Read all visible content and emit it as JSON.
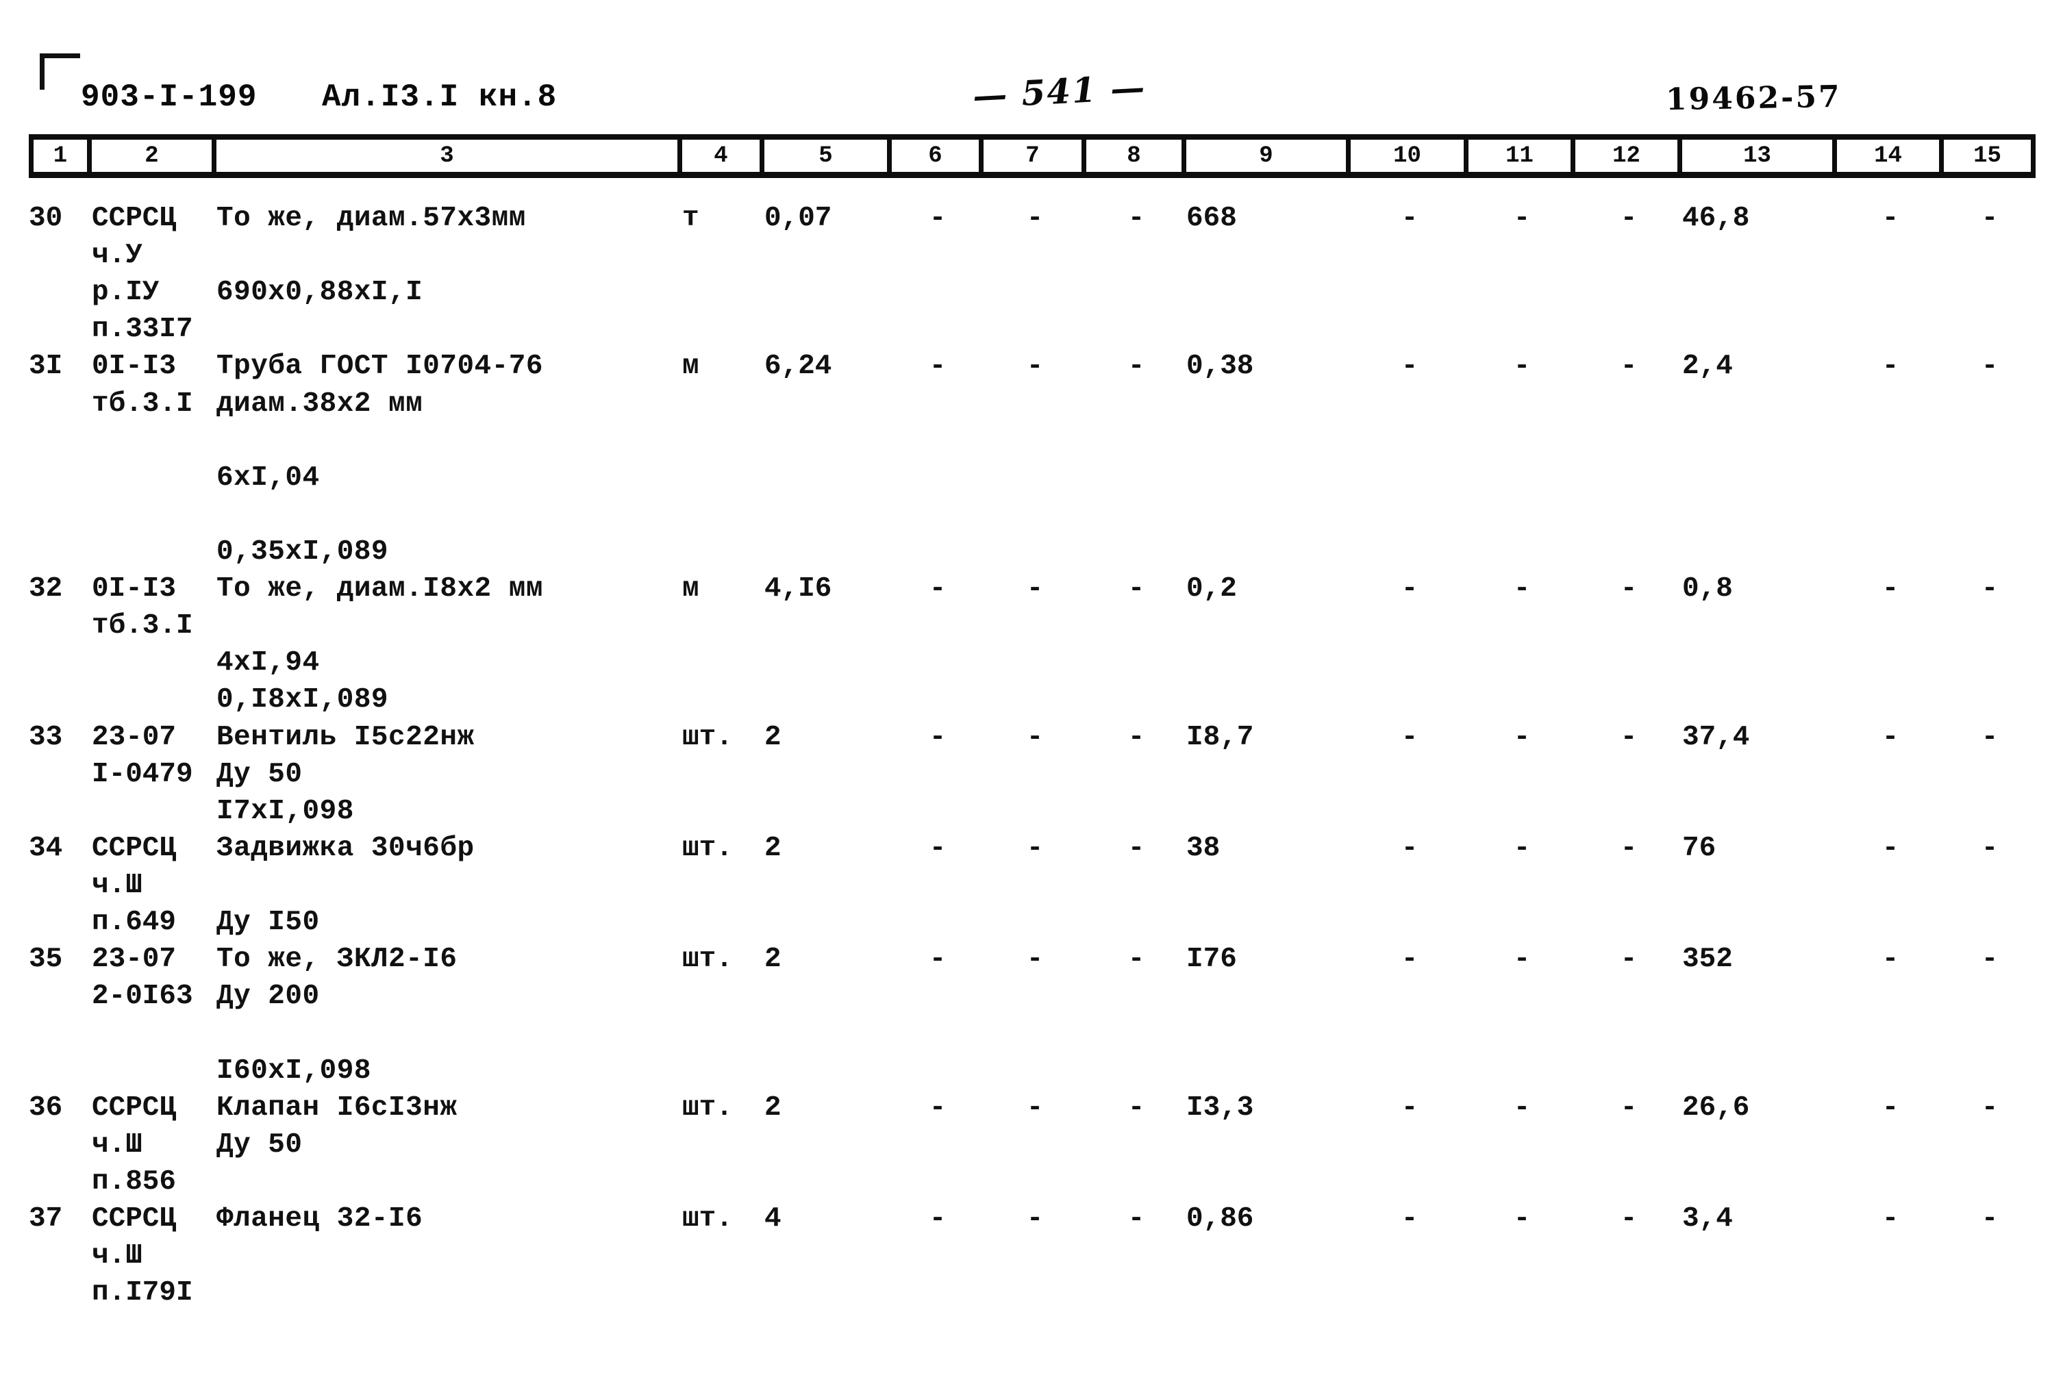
{
  "header": {
    "doc_code": "903-I-199",
    "album_ref": "Ал.I3.I кн.8",
    "page_number": "— 541 —",
    "archive_stamp": "19462-57"
  },
  "table": {
    "column_numbers": [
      "1",
      "2",
      "3",
      "4",
      "5",
      "6",
      "7",
      "8",
      "9",
      "10",
      "11",
      "12",
      "13",
      "14",
      "15"
    ],
    "dash": "-",
    "rows": [
      {
        "no": "30",
        "justification": "ССРСЦ\nч.У\nр.IУ\nп.33I7",
        "name": "То же, диам.57х3мм\n\n690х0,88хI,I",
        "unit": "т",
        "c5": "0,07",
        "c6": "-",
        "c7": "-",
        "c8": "-",
        "c9": "668",
        "c10": "-",
        "c11": "-",
        "c12": "-",
        "c13": "46,8",
        "c14": "-",
        "c15": "-"
      },
      {
        "no": "3I",
        "justification": "0I-I3\nтб.3.I",
        "name": "Труба ГОСТ I0704-76\nдиам.38х2 мм\n\n6хI,04\n\n0,35хI,089",
        "unit": "м",
        "c5": "6,24",
        "c6": "-",
        "c7": "-",
        "c8": "-",
        "c9": "0,38",
        "c10": "-",
        "c11": "-",
        "c12": "-",
        "c13": "2,4",
        "c14": "-",
        "c15": "-"
      },
      {
        "no": "32",
        "justification": "0I-I3\nтб.3.I",
        "name": "То же, диам.I8х2 мм\n\n4хI,94\n0,I8хI,089",
        "unit": "м",
        "c5": "4,I6",
        "c6": "-",
        "c7": "-",
        "c8": "-",
        "c9": "0,2",
        "c10": "-",
        "c11": "-",
        "c12": "-",
        "c13": "0,8",
        "c14": "-",
        "c15": "-"
      },
      {
        "no": "33",
        "justification": "23-07\nI-0479",
        "name": "Вентиль I5с22нж\nДу 50\nI7хI,098",
        "unit": "шт.",
        "c5": "2",
        "c6": "-",
        "c7": "-",
        "c8": "-",
        "c9": "I8,7",
        "c10": "-",
        "c11": "-",
        "c12": "-",
        "c13": "37,4",
        "c14": "-",
        "c15": "-"
      },
      {
        "no": "34",
        "justification": "ССРСЦ\nч.Ш\nп.649",
        "name": "Задвижка 30ч6бр\n\nДу I50",
        "unit": "шт.",
        "c5": "2",
        "c6": "-",
        "c7": "-",
        "c8": "-",
        "c9": "38",
        "c10": "-",
        "c11": "-",
        "c12": "-",
        "c13": "76",
        "c14": "-",
        "c15": "-"
      },
      {
        "no": "35",
        "justification": "23-07\n2-0I63",
        "name": "То же, ЗКЛ2-I6\nДу 200\n\nI60хI,098",
        "unit": "шт.",
        "c5": "2",
        "c6": "-",
        "c7": "-",
        "c8": "-",
        "c9": "I76",
        "c10": "-",
        "c11": "-",
        "c12": "-",
        "c13": "352",
        "c14": "-",
        "c15": "-"
      },
      {
        "no": "36",
        "justification": "ССРСЦ\nч.Ш\nп.856",
        "name": "Клапан I6сI3нж\nДу 50",
        "unit": "шт.",
        "c5": "2",
        "c6": "-",
        "c7": "-",
        "c8": "-",
        "c9": "I3,3",
        "c10": "-",
        "c11": "-",
        "c12": "-",
        "c13": "26,6",
        "c14": "-",
        "c15": "-"
      },
      {
        "no": "37",
        "justification": "ССРСЦ\nч.Ш\nп.I79I",
        "name": "Фланец 32-I6",
        "unit": "шт.",
        "c5": "4",
        "c6": "-",
        "c7": "-",
        "c8": "-",
        "c9": "0,86",
        "c10": "-",
        "c11": "-",
        "c12": "-",
        "c13": "3,4",
        "c14": "-",
        "c15": "-"
      }
    ]
  }
}
